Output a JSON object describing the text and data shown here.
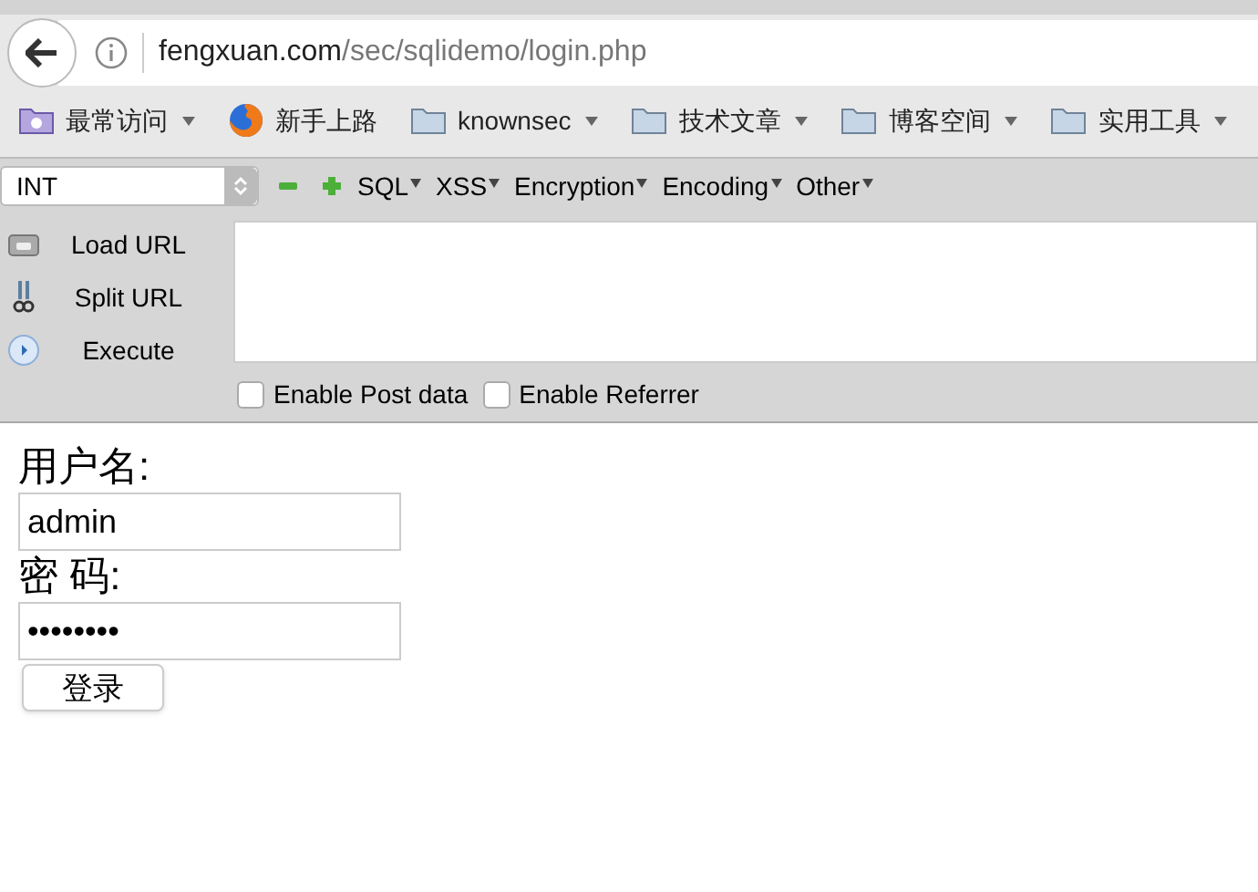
{
  "address_bar": {
    "url_host": "fengxuan.com",
    "url_path": "/sec/sqlidemo/login.php"
  },
  "bookmarks": [
    {
      "label": "最常访问",
      "kind": "smart",
      "dropdown": true
    },
    {
      "label": "新手上路",
      "kind": "browser",
      "dropdown": false
    },
    {
      "label": "knownsec",
      "kind": "folder",
      "dropdown": true
    },
    {
      "label": "技术文章",
      "kind": "folder",
      "dropdown": true
    },
    {
      "label": "博客空间",
      "kind": "folder",
      "dropdown": true
    },
    {
      "label": "实用工具",
      "kind": "folder",
      "dropdown": true
    }
  ],
  "hackbar": {
    "type_select": "INT",
    "menus": [
      "SQL",
      "XSS",
      "Encryption",
      "Encoding",
      "Other"
    ],
    "actions": [
      {
        "label": "Load URL",
        "kind": "load"
      },
      {
        "label": "Split URL",
        "kind": "split"
      },
      {
        "label": "Execute",
        "kind": "execute"
      }
    ],
    "options": [
      {
        "label": "Enable Post data",
        "checked": false
      },
      {
        "label": "Enable Referrer",
        "checked": false
      }
    ]
  },
  "login_form": {
    "username_label": "用户名:",
    "username_value": "admin",
    "password_label": "密 码:",
    "password_value": "••••••••",
    "submit": "登录"
  }
}
